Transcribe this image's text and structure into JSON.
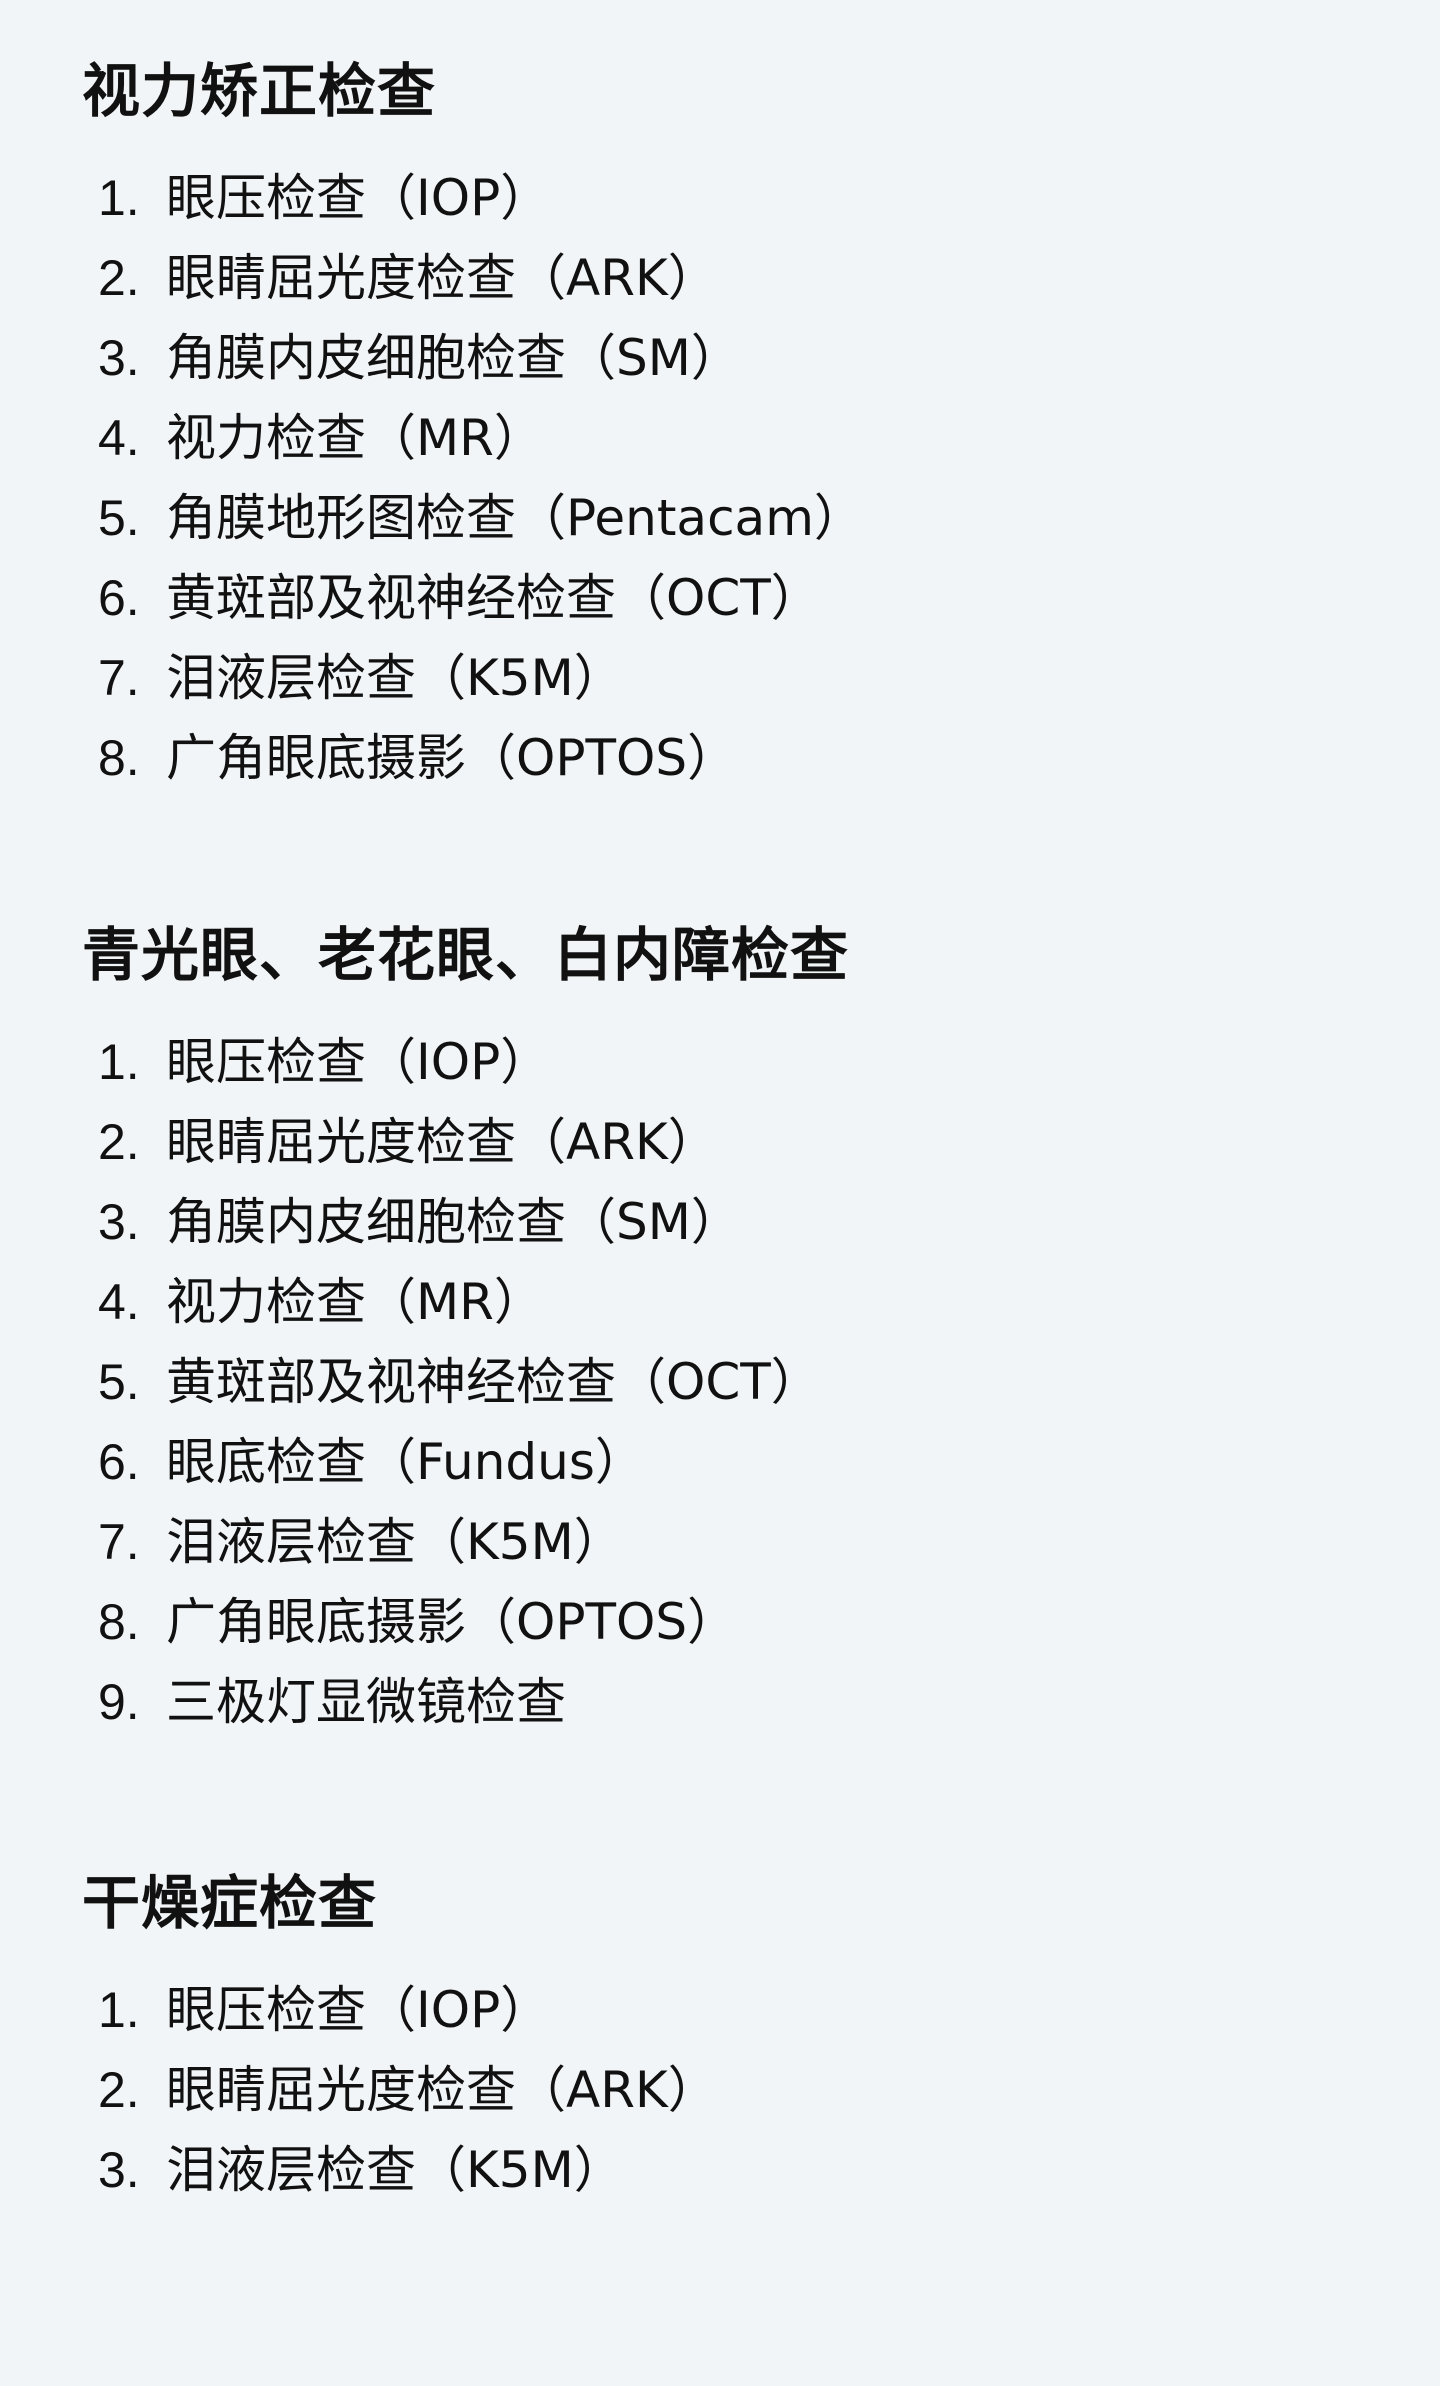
{
  "sections": [
    {
      "title": "视力矫正检查",
      "items": [
        {
          "num": "1.",
          "text": "眼压检查（IOP）"
        },
        {
          "num": "2.",
          "text": "眼睛屈光度检查（ARK）"
        },
        {
          "num": "3.",
          "text": "角膜内皮细胞检查（SM）"
        },
        {
          "num": "4.",
          "text": "视力检查（MR）"
        },
        {
          "num": "5.",
          "text": "角膜地形图检查（Pentacam）"
        },
        {
          "num": "6.",
          "text": "黄斑部及视神经检查（OCT）"
        },
        {
          "num": "7.",
          "text": "泪液层检查（K5M）"
        },
        {
          "num": "8.",
          "text": "广角眼底摄影（OPTOS）"
        }
      ]
    },
    {
      "title": "青光眼、老花眼、白内障检查",
      "items": [
        {
          "num": "1.",
          "text": "眼压检查（IOP）"
        },
        {
          "num": "2.",
          "text": "眼睛屈光度检查（ARK）"
        },
        {
          "num": "3.",
          "text": "角膜内皮细胞检查（SM）"
        },
        {
          "num": "4.",
          "text": "视力检查（MR）"
        },
        {
          "num": "5.",
          "text": "黄斑部及视神经检查（OCT）"
        },
        {
          "num": "6.",
          "text": "眼底检查（Fundus）"
        },
        {
          "num": "7.",
          "text": "泪液层检查（K5M）"
        },
        {
          "num": "8.",
          "text": "广角眼底摄影（OPTOS）"
        },
        {
          "num": "9.",
          "text": "三极灯显微镜检查"
        }
      ]
    },
    {
      "title": "干燥症检查",
      "items": [
        {
          "num": "1.",
          "text": "眼压检查（IOP）"
        },
        {
          "num": "2.",
          "text": "眼睛屈光度检查（ARK）"
        },
        {
          "num": "3.",
          "text": "泪液层检查（K5M）"
        }
      ]
    }
  ]
}
